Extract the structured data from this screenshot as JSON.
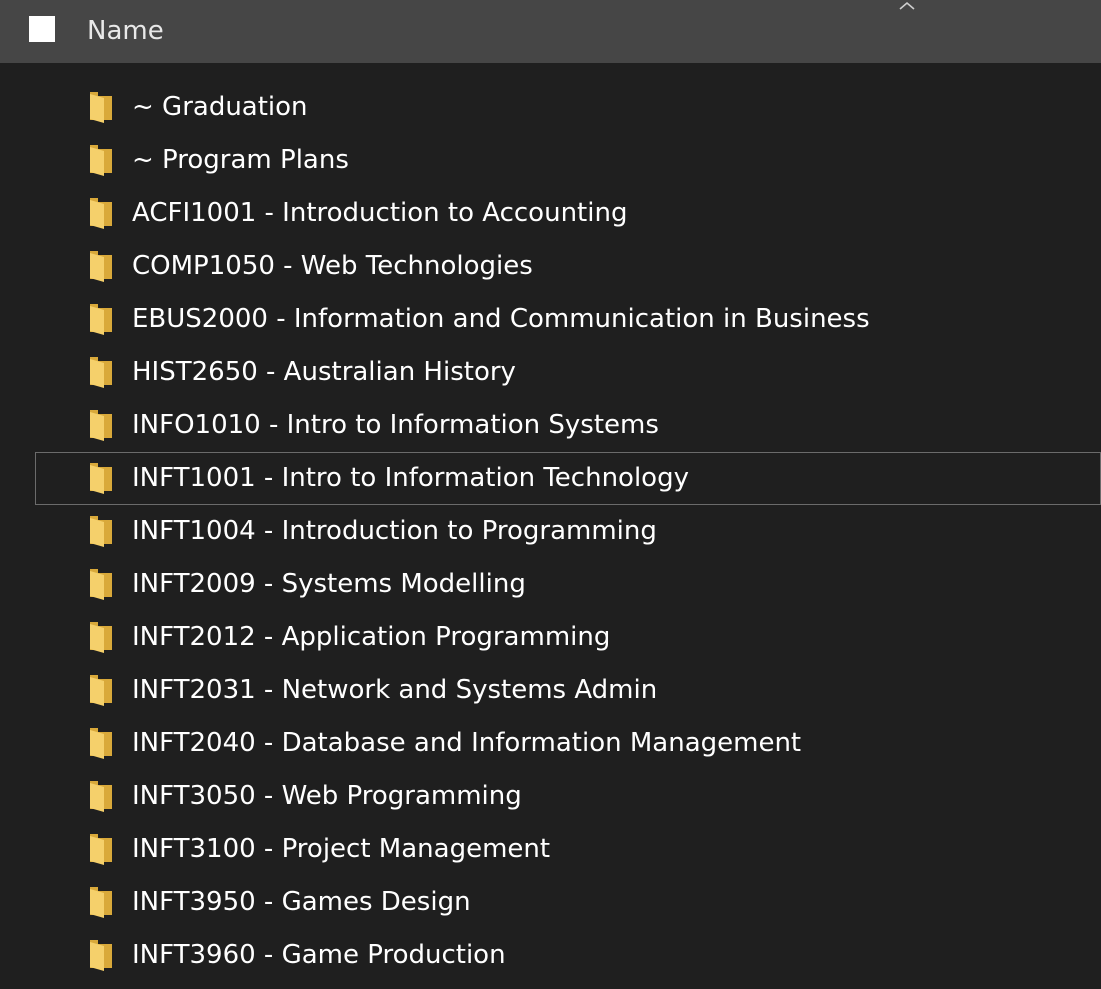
{
  "header": {
    "column_name": "Name",
    "checkbox_checked": false,
    "sort_direction": "ascending",
    "icons": {
      "checkbox": "select-all-checkbox",
      "sort": "chevron-up-icon"
    }
  },
  "colors": {
    "background": "#1f1f1f",
    "header_background": "#464646",
    "folder_front": "#f5d06b",
    "folder_back": "#d9a93a",
    "focus_border": "#6b6b6b"
  },
  "focused_index": 7,
  "items": [
    {
      "label": "~ Graduation",
      "icon": "folder-icon"
    },
    {
      "label": "~ Program Plans",
      "icon": "folder-icon"
    },
    {
      "label": "ACFI1001 - Introduction to Accounting",
      "icon": "folder-icon"
    },
    {
      "label": "COMP1050 - Web Technologies",
      "icon": "folder-icon"
    },
    {
      "label": "EBUS2000 - Information and Communication in Business",
      "icon": "folder-icon"
    },
    {
      "label": "HIST2650 - Australian History",
      "icon": "folder-icon"
    },
    {
      "label": "INFO1010 - Intro to Information Systems",
      "icon": "folder-icon"
    },
    {
      "label": "INFT1001 - Intro to Information Technology",
      "icon": "folder-icon"
    },
    {
      "label": "INFT1004 - Introduction to Programming",
      "icon": "folder-icon"
    },
    {
      "label": "INFT2009 - Systems Modelling",
      "icon": "folder-icon"
    },
    {
      "label": "INFT2012 - Application Programming",
      "icon": "folder-icon"
    },
    {
      "label": "INFT2031 - Network and Systems Admin",
      "icon": "folder-icon"
    },
    {
      "label": "INFT2040 - Database and Information Management",
      "icon": "folder-icon"
    },
    {
      "label": "INFT3050 - Web Programming",
      "icon": "folder-icon"
    },
    {
      "label": "INFT3100 - Project Management",
      "icon": "folder-icon"
    },
    {
      "label": "INFT3950 - Games Design",
      "icon": "folder-icon"
    },
    {
      "label": "INFT3960 - Game Production",
      "icon": "folder-icon"
    }
  ]
}
